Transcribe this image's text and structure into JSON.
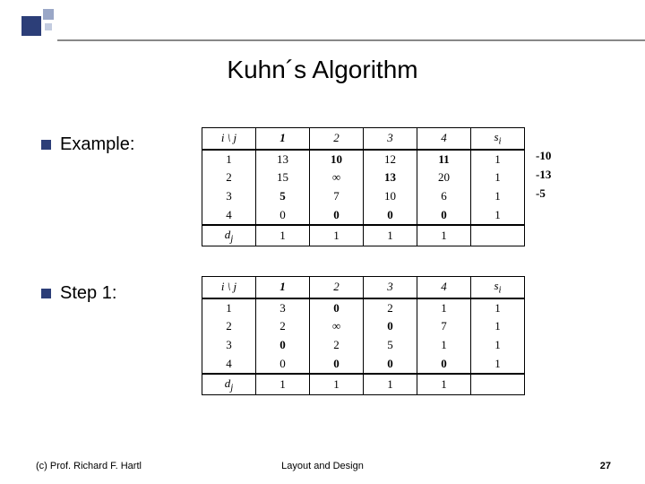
{
  "title": "Kuhn´s Algorithm",
  "bullets": {
    "example": "Example:",
    "step1": "Step 1:"
  },
  "table_header": {
    "corner": "i \\ j",
    "cols": [
      "1",
      "2",
      "3",
      "4"
    ],
    "si": "s",
    "si_sub": "i",
    "dj": "d",
    "dj_sub": "j"
  },
  "example_table": {
    "rows": [
      {
        "label": "1",
        "cells": [
          "13",
          "10",
          "12",
          "11"
        ],
        "si": "1"
      },
      {
        "label": "2",
        "cells": [
          "15",
          "∞",
          "13",
          "20"
        ],
        "si": "1"
      },
      {
        "label": "3",
        "cells": [
          "5",
          "7",
          "10",
          "6"
        ],
        "si": "1"
      },
      {
        "label": "4",
        "cells": [
          "0",
          "0",
          "0",
          "0"
        ],
        "si": "1"
      }
    ],
    "dj": [
      "1",
      "1",
      "1",
      "1"
    ],
    "extras": [
      "-10",
      "-13",
      "-5"
    ]
  },
  "step1_table": {
    "rows": [
      {
        "label": "1",
        "cells": [
          "3",
          "0",
          "2",
          "1"
        ],
        "si": "1"
      },
      {
        "label": "2",
        "cells": [
          "2",
          "∞",
          "0",
          "7"
        ],
        "si": "1"
      },
      {
        "label": "3",
        "cells": [
          "0",
          "2",
          "5",
          "1"
        ],
        "si": "1"
      },
      {
        "label": "4",
        "cells": [
          "0",
          "0",
          "0",
          "0"
        ],
        "si": "1"
      }
    ],
    "dj": [
      "1",
      "1",
      "1",
      "1"
    ]
  },
  "footer": {
    "copy": "(c) Prof. Richard F. Hartl",
    "center": "Layout and Design",
    "page": "27"
  },
  "chart_data": [
    {
      "type": "table",
      "title": "Example cost matrix",
      "row_labels": [
        "1",
        "2",
        "3",
        "4"
      ],
      "col_labels": [
        "1",
        "2",
        "3",
        "4"
      ],
      "values": [
        [
          13,
          10,
          12,
          11
        ],
        [
          15,
          null,
          13,
          20
        ],
        [
          5,
          7,
          10,
          6
        ],
        [
          0,
          0,
          0,
          0
        ]
      ],
      "supply_si": [
        1,
        1,
        1,
        1
      ],
      "demand_dj": [
        1,
        1,
        1,
        1
      ],
      "row_reductions": [
        -10,
        -13,
        -5
      ]
    },
    {
      "type": "table",
      "title": "Step 1 reduced matrix",
      "row_labels": [
        "1",
        "2",
        "3",
        "4"
      ],
      "col_labels": [
        "1",
        "2",
        "3",
        "4"
      ],
      "values": [
        [
          3,
          0,
          2,
          1
        ],
        [
          2,
          null,
          0,
          7
        ],
        [
          0,
          2,
          5,
          1
        ],
        [
          0,
          0,
          0,
          0
        ]
      ],
      "supply_si": [
        1,
        1,
        1,
        1
      ],
      "demand_dj": [
        1,
        1,
        1,
        1
      ]
    }
  ]
}
